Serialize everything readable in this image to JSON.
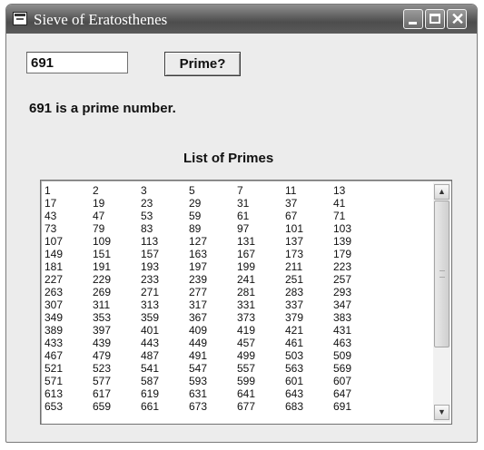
{
  "window": {
    "title": "Sieve of Eratosthenes"
  },
  "controls": {
    "input_value": "691",
    "button_label": "Prime?",
    "result_text": "691 is a prime number."
  },
  "list": {
    "heading": "List of Primes",
    "rows": [
      [
        "1",
        "2",
        "3",
        "5",
        "7",
        "11",
        "13"
      ],
      [
        "17",
        "19",
        "23",
        "29",
        "31",
        "37",
        "41"
      ],
      [
        "43",
        "47",
        "53",
        "59",
        "61",
        "67",
        "71"
      ],
      [
        "73",
        "79",
        "83",
        "89",
        "97",
        "101",
        "103"
      ],
      [
        "107",
        "109",
        "113",
        "127",
        "131",
        "137",
        "139"
      ],
      [
        "149",
        "151",
        "157",
        "163",
        "167",
        "173",
        "179"
      ],
      [
        "181",
        "191",
        "193",
        "197",
        "199",
        "211",
        "223"
      ],
      [
        "227",
        "229",
        "233",
        "239",
        "241",
        "251",
        "257"
      ],
      [
        "263",
        "269",
        "271",
        "277",
        "281",
        "283",
        "293"
      ],
      [
        "307",
        "311",
        "313",
        "317",
        "331",
        "337",
        "347"
      ],
      [
        "349",
        "353",
        "359",
        "367",
        "373",
        "379",
        "383"
      ],
      [
        "389",
        "397",
        "401",
        "409",
        "419",
        "421",
        "431"
      ],
      [
        "433",
        "439",
        "443",
        "449",
        "457",
        "461",
        "463"
      ],
      [
        "467",
        "479",
        "487",
        "491",
        "499",
        "503",
        "509"
      ],
      [
        "521",
        "523",
        "541",
        "547",
        "557",
        "563",
        "569"
      ],
      [
        "571",
        "577",
        "587",
        "593",
        "599",
        "601",
        "607"
      ],
      [
        "613",
        "617",
        "619",
        "631",
        "641",
        "643",
        "647"
      ],
      [
        "653",
        "659",
        "661",
        "673",
        "677",
        "683",
        "691"
      ]
    ]
  },
  "icons": {
    "app": "app-window-icon",
    "minimize": "minimize-icon",
    "maximize": "maximize-icon",
    "close": "close-icon",
    "scroll_up": "scroll-up-icon",
    "scroll_down": "scroll-down-icon"
  }
}
